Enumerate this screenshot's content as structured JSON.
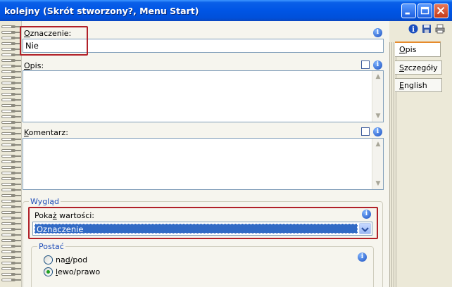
{
  "window": {
    "title": "kolejny (Skrót stworzony?, Menu Start)",
    "buttons": [
      "minimize",
      "maximize",
      "close"
    ]
  },
  "form": {
    "oznaczenie": {
      "label_prefix": "O",
      "label_rest": "znaczenie:",
      "value": "Nie"
    },
    "opis": {
      "label_prefix": "O",
      "label_rest": "pis:",
      "value": ""
    },
    "komentarz": {
      "label_prefix": "K",
      "label_rest": "omentarz:",
      "value": ""
    },
    "wyglad": {
      "title": "Wygląd",
      "pokaz": {
        "label_pre": "Poka",
        "label_ul": "ż",
        "label_post": " wartości:",
        "selected": "Oznaczenie"
      },
      "postac": {
        "title": "Postać",
        "options": [
          {
            "pre": "na",
            "ul": "d",
            "post": "/pod",
            "checked": false
          },
          {
            "pre": "",
            "ul": "l",
            "post": "ewo/prawo",
            "checked": true
          }
        ]
      }
    }
  },
  "tabs": [
    {
      "pre": "",
      "ul": "O",
      "post": "pis",
      "active": true
    },
    {
      "pre": "",
      "ul": "S",
      "post": "zczegóły",
      "active": false
    },
    {
      "pre": "",
      "ul": "E",
      "post": "nglish",
      "active": false
    }
  ],
  "toolbar": {
    "icons": [
      "info-icon",
      "save-icon",
      "print-icon"
    ]
  },
  "colors": {
    "titlebar": "#0055E5",
    "highlight": "#B12028",
    "selection": "#316AC5",
    "group_title": "#1F4DB8",
    "tab_accent": "#E68B2C"
  }
}
